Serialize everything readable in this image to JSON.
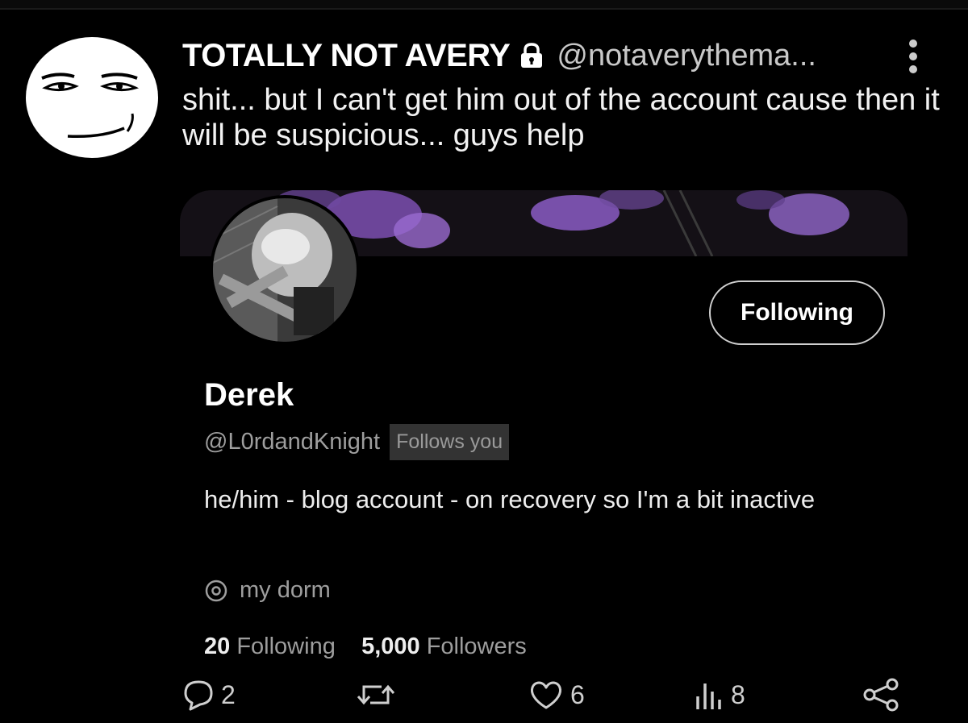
{
  "tweet": {
    "display_name": "TOTALLY NOT AVERY",
    "handle": "@notaverythema...",
    "text": "shit... but I can't get him out of the account cause then it will be suspicious... guys help"
  },
  "profile": {
    "name": "Derek",
    "handle": "@L0rdandKnight",
    "follows_you": "Follows you",
    "follow_button": "Following",
    "bio": "he/him - blog account - on recovery so I'm a bit inactive",
    "location": "my dorm",
    "following_count": "20",
    "following_label": "Following",
    "followers_count": "5,000",
    "followers_label": "Followers"
  },
  "actions": {
    "replies": "2",
    "likes": "6",
    "views": "8"
  },
  "icons": [
    "man-face-avatar",
    "lock-icon",
    "more-icon",
    "location-pin-icon",
    "reply-icon",
    "retweet-icon",
    "like-icon",
    "views-icon",
    "share-icon"
  ],
  "colors": {
    "background": "#000000",
    "text": "#ffffff",
    "muted": "#9e9e9e",
    "banner_accent": "#8a5cc4"
  }
}
